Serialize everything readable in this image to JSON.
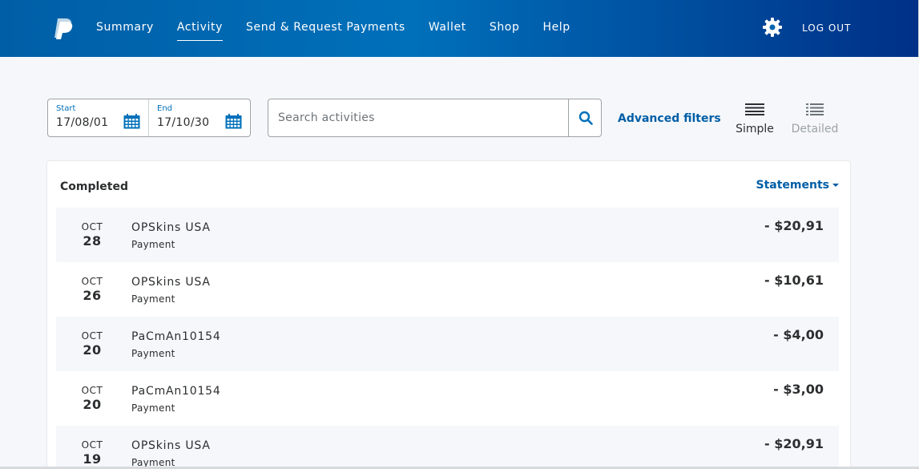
{
  "header": {
    "nav": [
      "Summary",
      "Activity",
      "Send & Request Payments",
      "Wallet",
      "Shop",
      "Help"
    ],
    "active_nav": "Activity",
    "logout_label": "LOG OUT",
    "logo_icon": "paypal-logo",
    "settings_icon": "gear-icon"
  },
  "filters": {
    "start_caption": "Start",
    "start_value": "17/08/01",
    "end_caption": "End",
    "end_value": "17/10/30",
    "search_placeholder": "Search activities",
    "advanced_label": "Advanced filters",
    "view_simple_label": "Simple",
    "view_detailed_label": "Detailed",
    "selected_view": "Simple"
  },
  "activity": {
    "section_title": "Completed",
    "statements_label": "Statements",
    "rows": [
      {
        "month": "OCT",
        "day": "28",
        "name": "OPSkins USA",
        "type": "Payment",
        "amount": "- $20,91"
      },
      {
        "month": "OCT",
        "day": "26",
        "name": "OPSkins USA",
        "type": "Payment",
        "amount": "- $10,61"
      },
      {
        "month": "OCT",
        "day": "20",
        "name": "PaCmAn10154",
        "type": "Payment",
        "amount": "- $4,00"
      },
      {
        "month": "OCT",
        "day": "20",
        "name": "PaCmAn10154",
        "type": "Payment",
        "amount": "- $3,00"
      },
      {
        "month": "OCT",
        "day": "19",
        "name": "OPSkins USA",
        "type": "Payment",
        "amount": "- $20,91"
      }
    ]
  },
  "colors": {
    "header_start": "#005ea6",
    "header_end": "#003087",
    "link": "#005ea6",
    "page_bg": "#f5f7fa"
  }
}
